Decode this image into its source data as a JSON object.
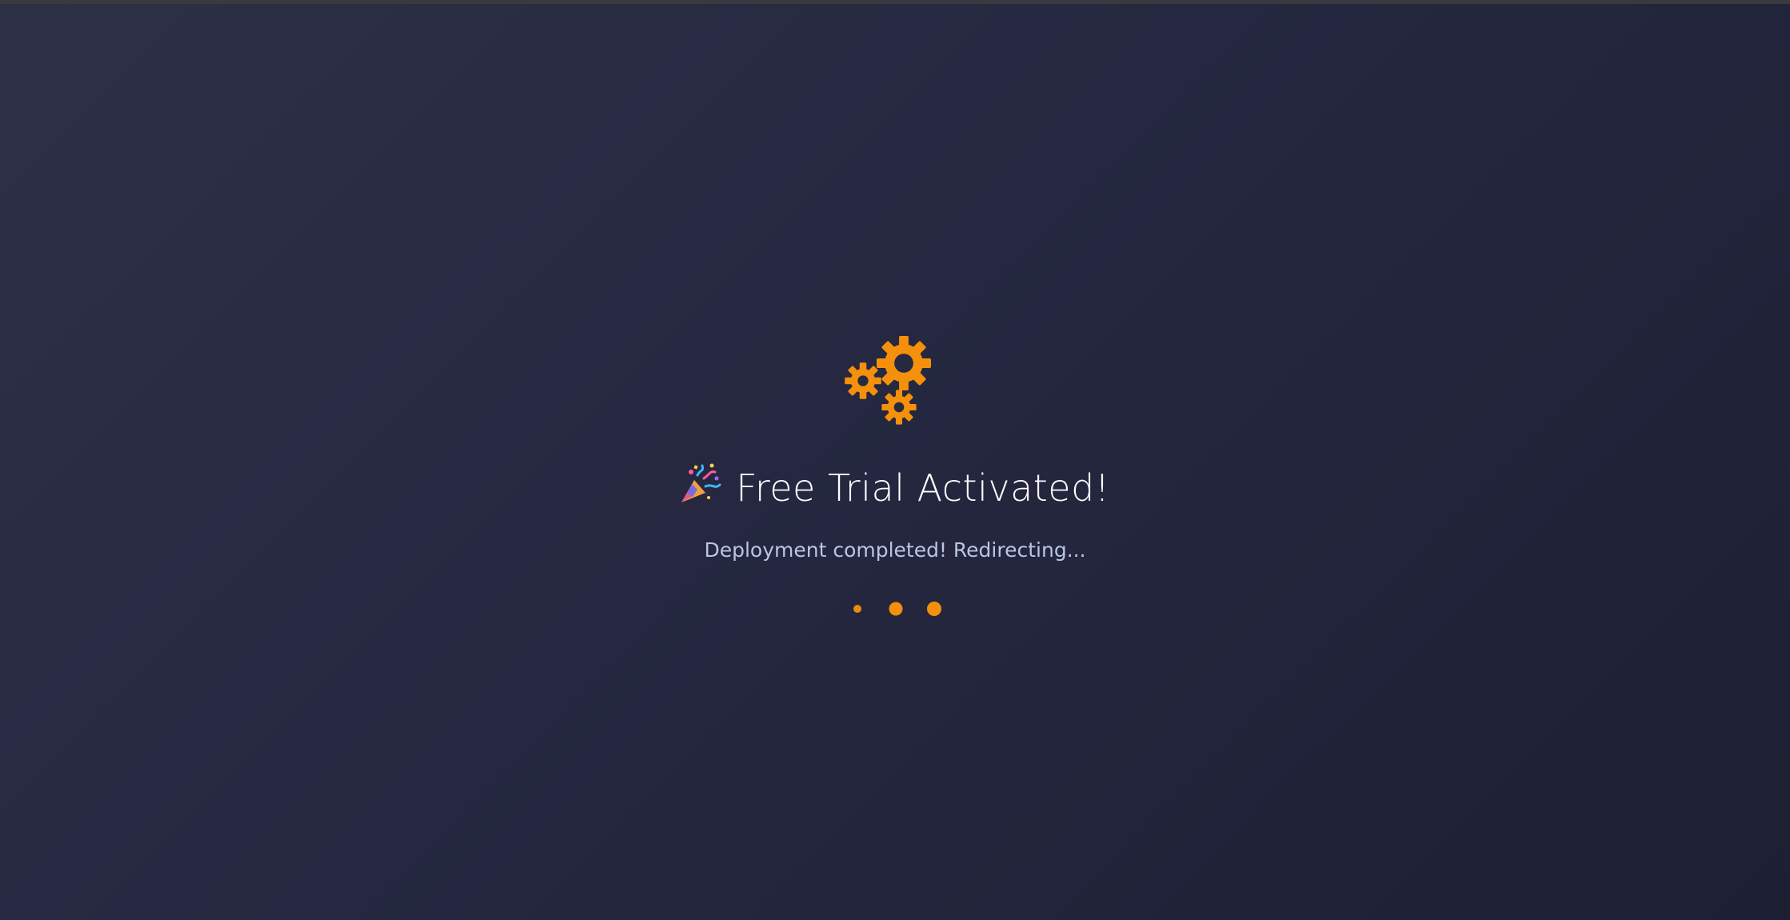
{
  "status": {
    "title": "Free Trial Activated!",
    "message": "Deployment completed! Redirecting...",
    "icon": "gears-icon",
    "title_icon": "party-popper-icon",
    "loader": "loading-dots",
    "accent_color": "#f5900c"
  }
}
